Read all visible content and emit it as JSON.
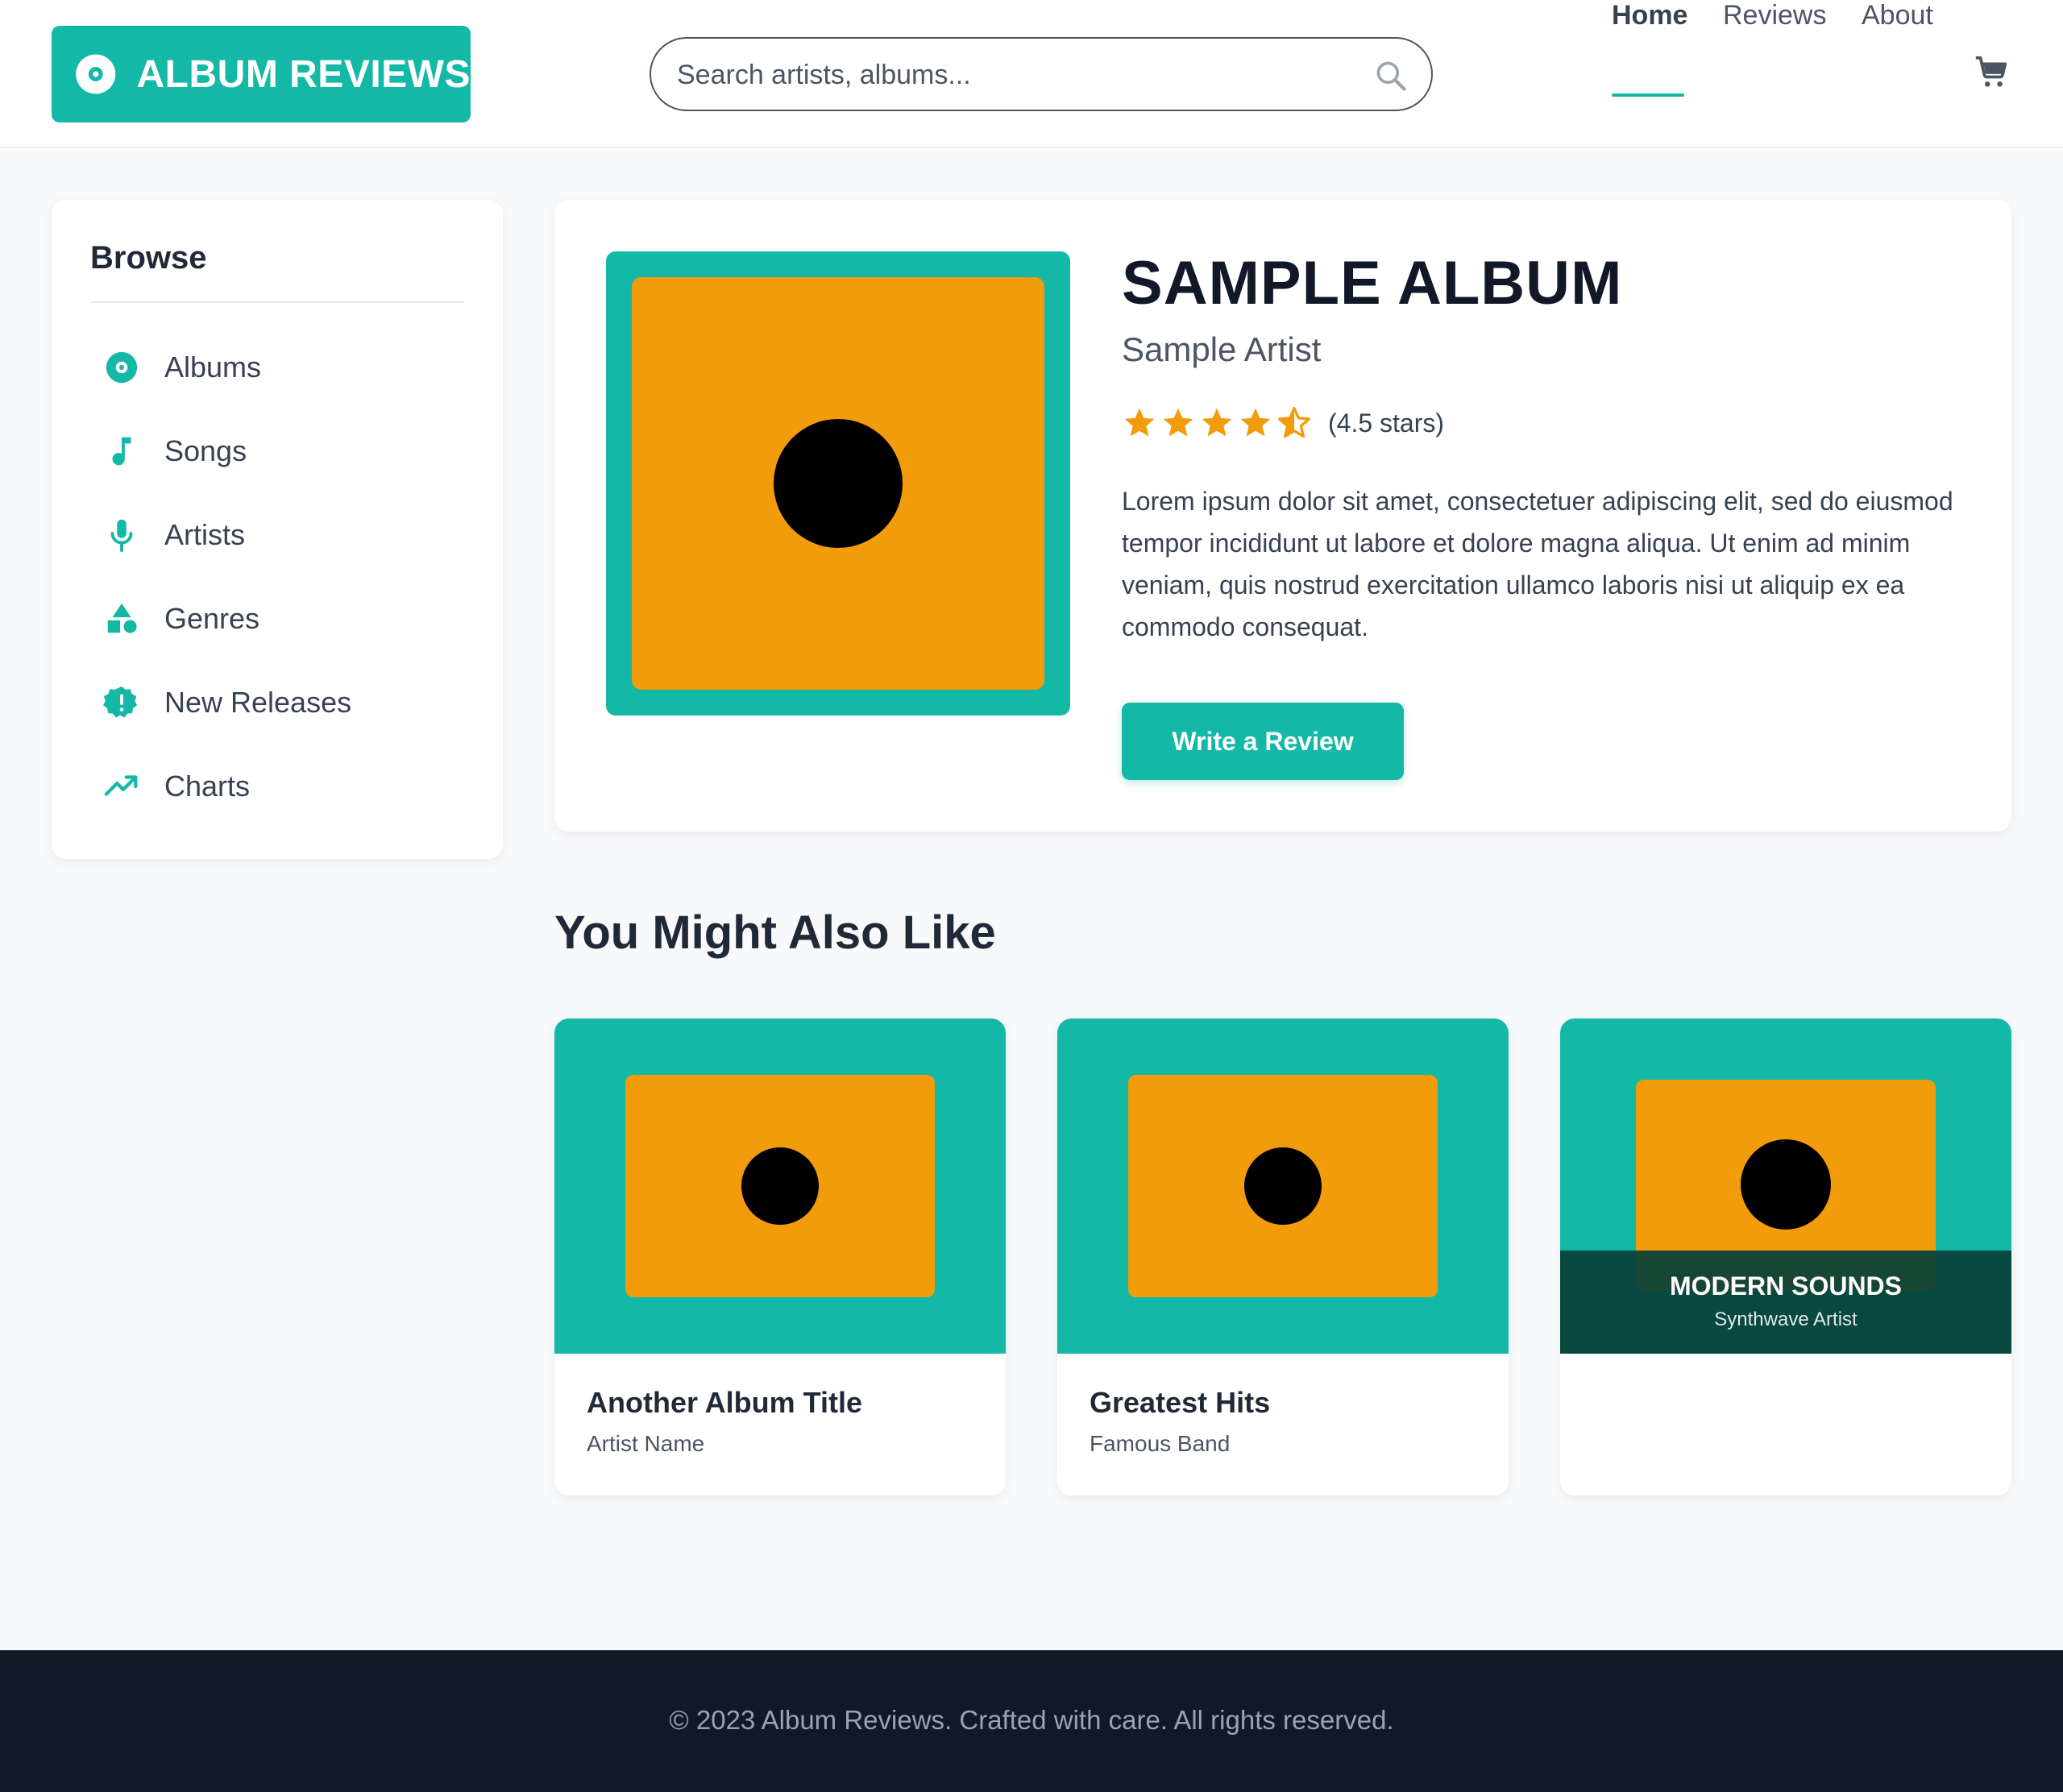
{
  "header": {
    "logo_text": "ALBUM REVIEWS",
    "logo_icon": "disc-icon",
    "search": {
      "placeholder": "Search artists, albums...",
      "value": ""
    },
    "nav": [
      {
        "label": "Home",
        "active": true
      },
      {
        "label": "Reviews",
        "active": false
      },
      {
        "label": "About",
        "active": false
      }
    ],
    "cart_icon": "cart-icon"
  },
  "sidebar": {
    "title": "Browse",
    "items": [
      {
        "label": "Albums",
        "icon": "disc-icon"
      },
      {
        "label": "Songs",
        "icon": "music-note-icon"
      },
      {
        "label": "Artists",
        "icon": "microphone-icon"
      },
      {
        "label": "Genres",
        "icon": "shapes-icon"
      },
      {
        "label": "New Releases",
        "icon": "new-badge-icon"
      },
      {
        "label": "Charts",
        "icon": "trending-up-icon"
      }
    ]
  },
  "album": {
    "title": "SAMPLE ALBUM",
    "artist": "Sample Artist",
    "rating": 4.5,
    "rating_text": "(4.5 stars)",
    "description": "Lorem ipsum dolor sit amet, consectetuer adipiscing elit, sed do eiusmod tempor incididunt ut labore et dolore magna aliqua. Ut enim ad minim veniam, quis nostrud exercitation ullamco laboris nisi ut aliquip ex ea commodo consequat.",
    "button_label": "Write a Review"
  },
  "recommendations": {
    "title": "You Might Also Like",
    "items": [
      {
        "title": "Another Album Title",
        "artist": "Artist Name"
      },
      {
        "title": "Greatest Hits",
        "artist": "Famous Band"
      },
      {
        "overlay_title": "MODERN SOUNDS",
        "overlay_artist": "Synthwave Artist"
      }
    ]
  },
  "footer": {
    "text": "© 2023 Album Reviews. Crafted with care. All rights reserved."
  },
  "colors": {
    "accent": "#14b8a6",
    "cover_orange": "#f39c0b",
    "star": "#f39c0b",
    "footer_bg": "#111827"
  }
}
